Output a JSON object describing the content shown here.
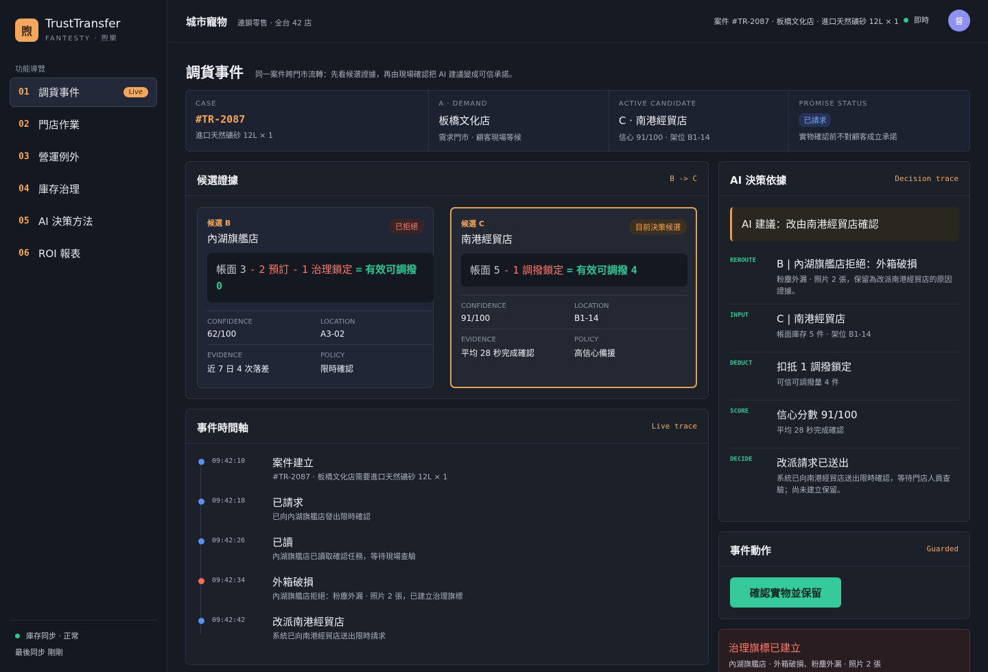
{
  "brand": {
    "logo": "煦",
    "name": "TrustTransfer",
    "sub": "FANTESTY · 煦樂"
  },
  "nav": {
    "title": "功能導覽",
    "items": [
      {
        "num": "01",
        "label": "調貨事件",
        "badge": "Live"
      },
      {
        "num": "02",
        "label": "門店作業"
      },
      {
        "num": "03",
        "label": "營運例外"
      },
      {
        "num": "04",
        "label": "庫存治理"
      },
      {
        "num": "05",
        "label": "AI 決策方法"
      },
      {
        "num": "06",
        "label": "ROI 報表"
      }
    ]
  },
  "sync": {
    "status": "庫存同步 · 正常",
    "last": "最後同步 剛剛"
  },
  "topbar": {
    "title": "城市寵物",
    "sub": "連鎖零售 · 全台 42 店",
    "case": "案件 #TR-2087 · 板橋文化店 · 進口天然礦砂 12L × 1",
    "live": "即時",
    "avatar": "督"
  },
  "page": {
    "title": "調貨事件",
    "desc": "同一案件跨門市流轉：先看候選證據，再由現場確認把 AI 建議變成可信承諾。"
  },
  "summary": {
    "case": {
      "label": "CASE",
      "value": "#TR-2087",
      "note": "進口天然礦砂 12L × 1"
    },
    "demand": {
      "label": "A · DEMAND",
      "value": "板橋文化店",
      "note": "需求門市 · 顧客現場等候"
    },
    "candidate": {
      "label": "ACTIVE CANDIDATE",
      "value": "C · 南港經貿店",
      "note": "信心 91/100 · 架位 B1-14"
    },
    "promise": {
      "label": "PROMISE STATUS",
      "pill": "已請求",
      "note": "實物確認前不對顧客成立承諾"
    }
  },
  "candidates": {
    "title": "候選證據",
    "tag": "B -> C",
    "b": {
      "tag": "候選 B",
      "name": "內湖旗艦店",
      "status": "已拒絕",
      "f1": "帳面",
      "n1": "3",
      "op1": "-",
      "n2": "2",
      "t2": "預訂",
      "op2": "-",
      "n3": "1",
      "t3": "治理鎖定",
      "eq": "=",
      "res": "有效可調撥",
      "rv": "0",
      "meta": {
        "confidence_label": "CONFIDENCE",
        "confidence": "62/100",
        "location_label": "LOCATION",
        "location": "A3-02",
        "evidence_label": "EVIDENCE",
        "evidence": "近 7 日 4 次落差",
        "policy_label": "POLICY",
        "policy": "限時確認"
      }
    },
    "c": {
      "tag": "候選 C",
      "name": "南港經貿店",
      "status": "目前決策候選",
      "f1": "帳面",
      "n1": "5",
      "op1": "-",
      "n2": "1",
      "t2": "調撥鎖定",
      "eq": "=",
      "res": "有效可調撥",
      "rv": "4",
      "meta": {
        "confidence_label": "CONFIDENCE",
        "confidence": "91/100",
        "location_label": "LOCATION",
        "location": "B1-14",
        "evidence_label": "EVIDENCE",
        "evidence": "平均 28 秒完成確認",
        "policy_label": "POLICY",
        "policy": "高信心備援"
      }
    }
  },
  "timeline": {
    "title": "事件時間軸",
    "tag": "Live trace",
    "items": [
      {
        "time": "09:42:10",
        "title": "案件建立",
        "desc": "#TR-2087 · 板橋文化店需要進口天然礦砂 12L × 1"
      },
      {
        "time": "09:42:18",
        "title": "已請求",
        "desc": "已向內湖旗艦店發出限時確認"
      },
      {
        "time": "09:42:26",
        "title": "已讀",
        "desc": "內湖旗艦店已讀取確認任務，等待現場查驗"
      },
      {
        "time": "09:42:34",
        "title": "外箱破損",
        "desc": "內湖旗艦店拒絕：粉塵外漏 · 照片 2 張，已建立治理旗標"
      },
      {
        "time": "09:42:42",
        "title": "改派南港經貿店",
        "desc": "系統已向南港經貿店送出限時請求"
      }
    ]
  },
  "ai": {
    "title": "AI 決策依據",
    "tag": "Decision trace",
    "callout": "AI 建議：改由南港經貿店確認",
    "steps": [
      {
        "key": "REROUTE",
        "head": "B | 內湖旗艦店拒絕：外箱破損",
        "body": "粉塵外漏 · 照片 2 張，保留為改派南港經貿店的原因證據。"
      },
      {
        "key": "INPUT",
        "head": "C | 南港經貿店",
        "body": "帳面庫存 5 件 · 架位 B1-14"
      },
      {
        "key": "DEDUCT",
        "head": "扣抵 1 調撥鎖定",
        "body": "可信可調撥量 4 件"
      },
      {
        "key": "SCORE",
        "head": "信心分數 91/100",
        "body": "平均 28 秒完成確認"
      },
      {
        "key": "DECIDE",
        "head": "改派請求已送出",
        "body": "系統已向南港經貿店送出限時確認，等待門店人員查驗；尚未建立保留。"
      }
    ]
  },
  "actions": {
    "title": "事件動作",
    "tag": "Guarded",
    "primary": "確認實物並保留"
  },
  "alert": {
    "title": "治理旗標已建立",
    "desc": "內湖旗艦店 · 外箱破損、粉塵外漏 · 照片 2 張"
  },
  "colors": {
    "accent": "#f3a75c",
    "ok": "#31c493",
    "danger": "#ff7a6b",
    "info": "#5b8ef0"
  }
}
